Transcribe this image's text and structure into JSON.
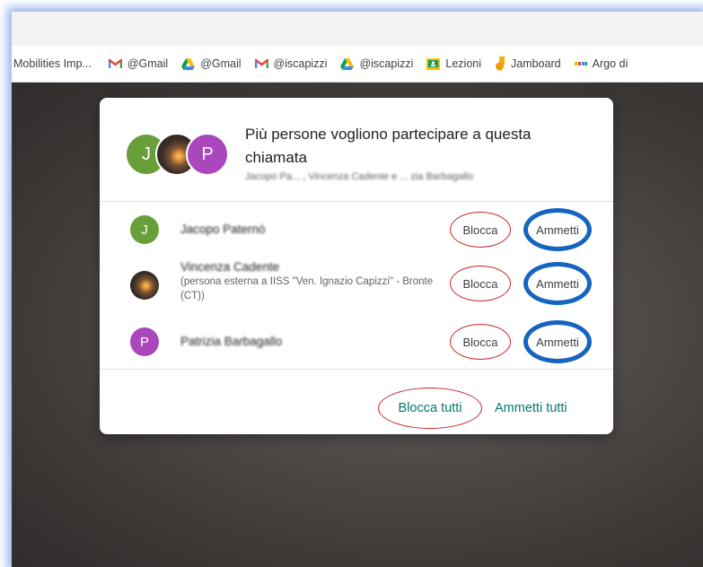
{
  "bookmarks": [
    {
      "label": "Mobilities Imp...",
      "icon": "page-icon"
    },
    {
      "label": "@Gmail",
      "icon": "gmail-icon"
    },
    {
      "label": "@Gmail",
      "icon": "google-drive-icon"
    },
    {
      "label": "@iscapizzi",
      "icon": "gmail-icon"
    },
    {
      "label": "@iscapizzi",
      "icon": "google-drive-icon"
    },
    {
      "label": "Lezioni",
      "icon": "google-classroom-icon"
    },
    {
      "label": "Jamboard",
      "icon": "jamboard-icon"
    },
    {
      "label": "Argo di",
      "icon": "argo-icon"
    }
  ],
  "dialog": {
    "title": "Più persone vogliono partecipare a questa chiamata",
    "subtitle": "Jacopo Pa... , Vincenza Cadente e ... zia Barbagallo",
    "avatars": [
      "J",
      "",
      "P"
    ],
    "participants": [
      {
        "initial": "J",
        "name": "Jacopo Paternò",
        "description": "",
        "block_label": "Blocca",
        "admit_label": "Ammetti"
      },
      {
        "initial": "",
        "name": "Vincenza Cadente",
        "description": "(persona esterna a IISS \"Ven. Ignazio Capizzi\" - Bronte (CT))",
        "block_label": "Blocca",
        "admit_label": "Ammetti"
      },
      {
        "initial": "P",
        "name": "Patrizia Barbagallo",
        "description": "",
        "block_label": "Blocca",
        "admit_label": "Ammetti"
      }
    ],
    "block_all_label": "Blocca tutti",
    "admit_all_label": "Ammetti tutti"
  },
  "colors": {
    "accent_text": "#00796b",
    "annotation_red": "#c62828",
    "annotation_blue": "#1565c0",
    "frame_glow": "#789bea"
  }
}
